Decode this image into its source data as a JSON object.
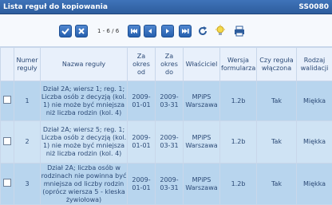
{
  "window": {
    "title": "Lista reguł do kopiowania",
    "code": "SS0080"
  },
  "toolbar": {
    "pager_text": "1 - 6 / 6",
    "buttons": [
      "check-icon",
      "close-icon",
      "first-page-icon",
      "previous-page-icon",
      "next-page-icon",
      "last-page-icon",
      "refresh-icon",
      "lightbulb-icon",
      "print-icon"
    ]
  },
  "table": {
    "headers": [
      "Numer reguły",
      "Nazwa reguły",
      "Za okres od",
      "Za okres do",
      "Właściciel",
      "Wersja formularza",
      "Czy reguła włączona",
      "Rodzaj walidacji"
    ],
    "rows": [
      {
        "num": "1",
        "name": "Dział 2A; wiersz 1; reg. 1; Liczba osób z decyzją (kol. 1) nie może być mniejsza niż liczba rodzin (kol. 4)",
        "from": "2009-01-01",
        "to": "2009-03-31",
        "owner": "MPiPS Warszawa",
        "version": "1.2b",
        "enabled": "Tak",
        "type": "Miękka"
      },
      {
        "num": "2",
        "name": "Dział 2A; wiersz 5; reg. 1; Liczba osób z decyzją (kol. 1) nie może być mniejsza niż liczba rodzin (kol. 4)",
        "from": "2009-01-01",
        "to": "2009-03-31",
        "owner": "MPiPS Warszawa",
        "version": "1.2b",
        "enabled": "Tak",
        "type": "Miękka"
      },
      {
        "num": "3",
        "name": "Dział 2A; liczba osób w rodzinach nie powinna być mniejsza od liczby rodzin (oprócz wiersza 5 - kleska żywiołowa)",
        "from": "2009-01-01",
        "to": "2009-03-31",
        "owner": "MPiPS Warszawa",
        "version": "1.2b",
        "enabled": "Tak",
        "type": "Miękka"
      }
    ]
  }
}
